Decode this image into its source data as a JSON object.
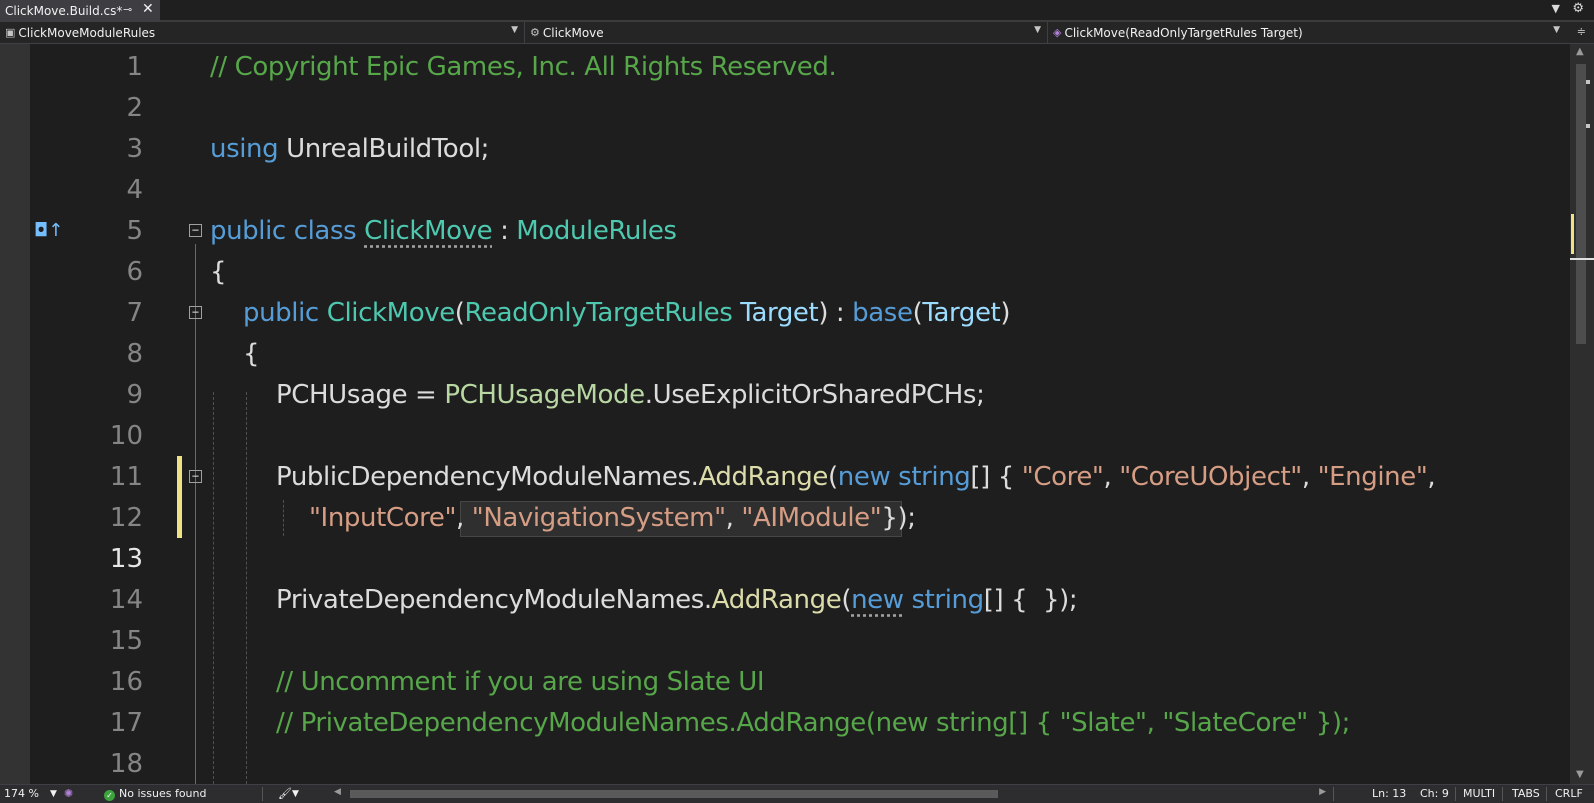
{
  "tab": {
    "title": "ClickMove.Build.cs*",
    "pin_icon": "pin-icon",
    "close_icon": "close-icon"
  },
  "navbar": {
    "project": "ClickMoveModuleRules",
    "class": "ClickMove",
    "member": "ClickMove(ReadOnlyTargetRules Target)"
  },
  "lines": [
    {
      "num": "1"
    },
    {
      "num": "2"
    },
    {
      "num": "3"
    },
    {
      "num": "4"
    },
    {
      "num": "5"
    },
    {
      "num": "6"
    },
    {
      "num": "7"
    },
    {
      "num": "8"
    },
    {
      "num": "9"
    },
    {
      "num": "10"
    },
    {
      "num": "11"
    },
    {
      "num": "12"
    },
    {
      "num": "13"
    },
    {
      "num": "14"
    },
    {
      "num": "15"
    },
    {
      "num": "16"
    },
    {
      "num": "17"
    },
    {
      "num": "18"
    }
  ],
  "code": {
    "l1": "// Copyright Epic Games, Inc. All Rights Reserved.",
    "l3_kw": "using",
    "l3_rest": " UnrealBuildTool;",
    "l5_kw1": "public",
    "l5_kw2": " class ",
    "l5_name": "ClickMove",
    "l5_colon": " : ",
    "l5_base": "ModuleRules",
    "l6": "{",
    "l7_kw": "public",
    "l7_name": " ClickMove",
    "l7_p1": "(",
    "l7_type": "ReadOnlyTargetRules",
    "l7_param": " Target",
    "l7_p2": ") : ",
    "l7_base": "base",
    "l7_p3": "(",
    "l7_arg": "Target",
    "l7_p4": ")",
    "l8": "{",
    "l9_a": "PCHUsage = ",
    "l9_type": "PCHUsageMode",
    "l9_b": ".UseExplicitOrSharedPCHs;",
    "l11_a": "PublicDependencyModuleNames.",
    "l11_meth": "AddRange",
    "l11_b": "(",
    "l11_kw1": "new",
    "l11_kw2": " string",
    "l11_c": "[] { ",
    "l11_s1": "\"Core\"",
    "l11_d": ", ",
    "l11_s2": "\"CoreUObject\"",
    "l11_e": ", ",
    "l11_s3": "\"Engine\"",
    "l11_f": ",",
    "l12_s1": "\"InputCore\"",
    "l12_a": ", ",
    "l12_s2": "\"NavigationSystem\"",
    "l12_b": ", ",
    "l12_s3": "\"AIModule\"",
    "l12_c": "});",
    "l14_a": "PrivateDependencyModuleNames.",
    "l14_meth": "AddRange",
    "l14_b": "(",
    "l14_kw1": "new",
    "l14_kw2": " string",
    "l14_c": "[] {  });",
    "l16": "// Uncomment if you are using Slate UI",
    "l17": "// PrivateDependencyModuleNames.AddRange(new string[] { \"Slate\", \"SlateCore\" });"
  },
  "status": {
    "zoom": "174 %",
    "issues": "No issues found",
    "line": "Ln: 13",
    "char": "Ch: 9",
    "mode": "MULTI",
    "indent": "TABS",
    "eol": "CRLF"
  },
  "colors": {
    "background": "#1e1e1e",
    "comment": "#57a64a",
    "keyword": "#569cd6",
    "type": "#4ec9b0",
    "method": "#dcdcaa",
    "string": "#d69d85",
    "parameter": "#9cdcfe"
  }
}
